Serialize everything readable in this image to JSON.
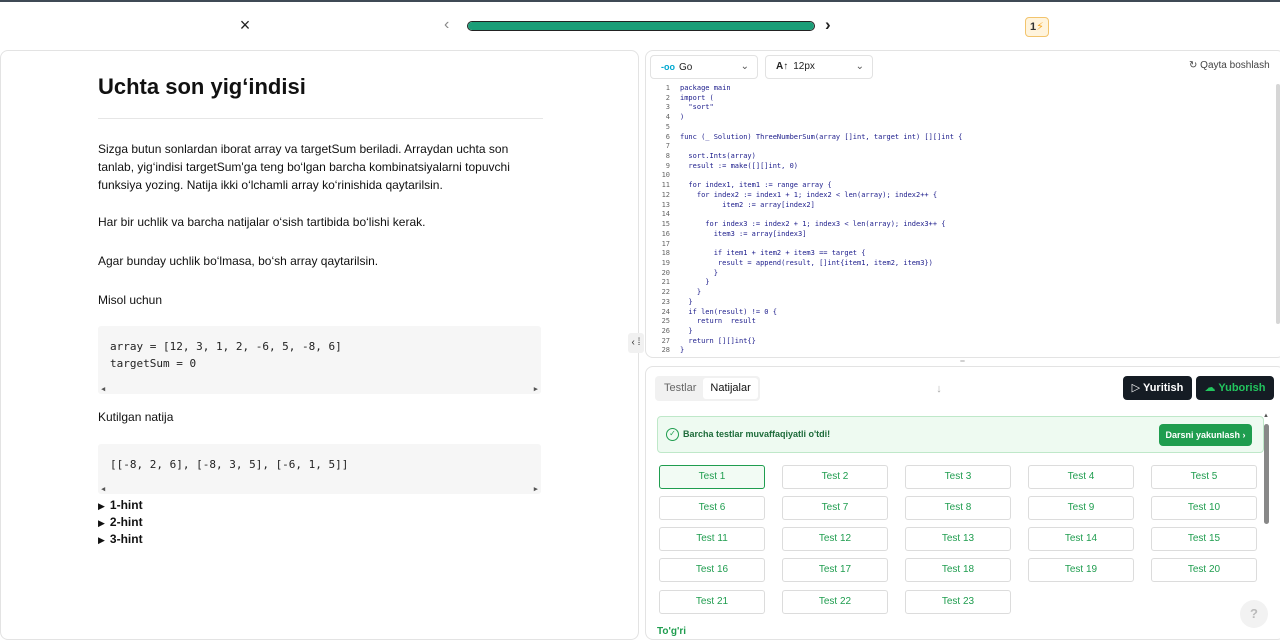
{
  "header": {
    "close_icon": "×",
    "prev_icon": "‹",
    "next_icon": "›",
    "progress_fraction": 1.0,
    "streak_count": "1",
    "streak_icon": "⚡"
  },
  "problem": {
    "title": "Uchta son yig‘indisi",
    "description": [
      "Sizga butun sonlardan iborat array va targetSum beriladi. Arraydan uchta son tanlab, yig‘indisi targetSum'ga teng bo‘lgan barcha kombinatsiyalarni topuvchi funksiya yozing. Natija ikki o‘lchamli array ko‘rinishida qaytarilsin.",
      "Har bir uchlik va barcha natijalar o‘sish tartibida bo‘lishi kerak.",
      "Agar bunday uchlik bo‘lmasa, bo‘sh array qaytarilsin.",
      "Misol uchun"
    ],
    "example_code": "array = [12, 3, 1, 2, -6, 5, -8, 6]\ntargetSum = 0",
    "expected_label": "Kutilgan natija",
    "expected_code": "[[-8, 2, 6], [-8, 3, 5], [-6, 1, 5]]",
    "hints": [
      "1-hint",
      "2-hint",
      "3-hint"
    ]
  },
  "editor": {
    "language": "Go",
    "language_icon": "go-gopher-icon",
    "font_size": "12px",
    "reset_label": "Qayta boshlash",
    "line_numbers": [
      "1",
      "2",
      "3",
      "4",
      "5",
      "6",
      "7",
      "8",
      "9",
      "10",
      "11",
      "12",
      "13",
      "14",
      "15",
      "16",
      "17",
      "18",
      "19",
      "20",
      "21",
      "22",
      "23",
      "24",
      "25",
      "26",
      "27",
      "28"
    ],
    "code": "package main\nimport (\n  \"sort\"\n)\n\nfunc (_ Solution) ThreeNumberSum(array []int, target int) [][]int {\n\n  sort.Ints(array)\n  result := make([][]int, 0)\n\n  for index1, item1 := range array {\n    for index2 := index1 + 1; index2 < len(array); index2++ {\n          item2 := array[index2]\n\n      for index3 := index2 + 1; index3 < len(array); index3++ {\n        item3 := array[index3]\n\n        if item1 + item2 + item3 == target {\n         result = append(result, []int{item1, item2, item3})\n        }\n      }\n    }\n  }\n  if len(result) != 0 {\n    return  result\n  }\n  return [][]int{}\n}"
  },
  "results": {
    "tabs": [
      {
        "label": "Testlar",
        "active": false
      },
      {
        "label": "Natijalar",
        "active": true
      }
    ],
    "run_label": "Yuritish",
    "submit_label": "Yuborish",
    "success_message": "Barcha testlar muvaffaqiyatli o'tdi!",
    "finish_label": "Darsni yakunlash",
    "tests": [
      "Test 1",
      "Test 2",
      "Test 3",
      "Test 4",
      "Test 5",
      "Test 6",
      "Test 7",
      "Test 8",
      "Test 9",
      "Test 10",
      "Test 11",
      "Test 12",
      "Test 13",
      "Test 14",
      "Test 15",
      "Test 16",
      "Test 17",
      "Test 18",
      "Test 19",
      "Test 20",
      "Test 21",
      "Test 22",
      "Test 23"
    ],
    "selected_test": "Test 1",
    "status_label": "To'g'ri",
    "help_label": "?"
  },
  "colors": {
    "accent_green": "#1f9d4f",
    "progress_green": "#1a9e78",
    "dark_button": "#151c24"
  }
}
